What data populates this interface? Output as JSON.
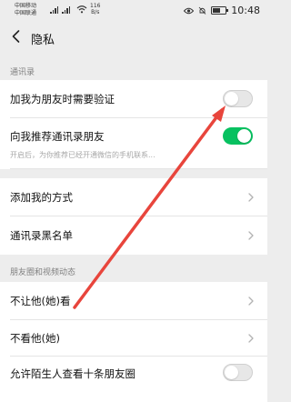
{
  "status_bar": {
    "carrier_1": "中国移动",
    "carrier_2": "中国联通",
    "speed_value": "116",
    "speed_unit": "B/s",
    "time": "10:48",
    "battery_level": 0.6
  },
  "nav": {
    "back_icon": "chevron-left-icon",
    "title": "隐私"
  },
  "sections": {
    "contacts_header": "通讯录",
    "moments_header": "朋友圈和视频动态"
  },
  "rows": {
    "friend_verify": {
      "label": "加我为朋友时需要验证",
      "toggle_on": false
    },
    "recommend_contacts": {
      "label": "向我推荐通讯录朋友",
      "desc": "开启后，为你推荐已经开通微信的手机联系...",
      "toggle_on": true
    },
    "add_methods": {
      "label": "添加我的方式"
    },
    "blacklist": {
      "label": "通讯录黑名单"
    },
    "hide_from": {
      "label": "不让他(她)看"
    },
    "dont_see": {
      "label": "不看他(她)"
    },
    "stranger_moments": {
      "label": "允许陌生人查看十条朋友圈",
      "toggle_on": false
    }
  },
  "colors": {
    "background": "#ededed",
    "toggle_on": "#07c160",
    "annotation_arrow": "#e8453c"
  }
}
